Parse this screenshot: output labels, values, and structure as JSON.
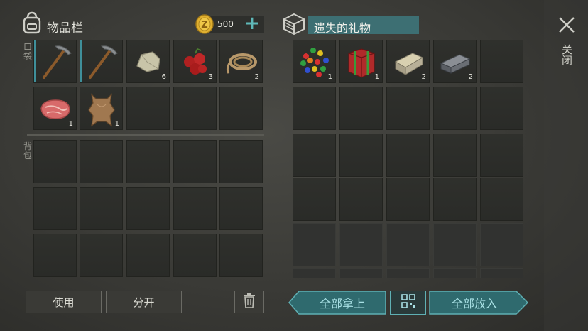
{
  "inventory": {
    "title": "物品栏",
    "pocket_label": "口袋",
    "backpack_label": "背包",
    "coins": "500",
    "add_label": "+",
    "pocket_items": [
      {
        "icon": "pickaxe-icon",
        "count": "",
        "equipped": true
      },
      {
        "icon": "pickaxe-icon",
        "count": "",
        "equipped": true
      },
      {
        "icon": "stone-icon",
        "count": "6"
      },
      {
        "icon": "berries-icon",
        "count": "3"
      },
      {
        "icon": "rope-icon",
        "count": "2"
      },
      {
        "icon": "raw-meat-icon",
        "count": "1"
      },
      {
        "icon": "leather-hide-icon",
        "count": "1"
      }
    ],
    "use_label": "使用",
    "split_label": "分开"
  },
  "gift": {
    "title": "遗失的礼物",
    "items": [
      {
        "icon": "colored-beads-icon",
        "count": "1"
      },
      {
        "icon": "gift-box-icon",
        "count": "1"
      },
      {
        "icon": "stone-brick-icon",
        "count": "2"
      },
      {
        "icon": "iron-ingot-icon",
        "count": "2"
      }
    ],
    "take_all_label": "全部拿上",
    "put_all_label": "全部放入"
  },
  "close_label": "关闭",
  "colors": {
    "accent": "#3f8f9a",
    "coin": "#e0b030",
    "title_bar": "#3d6f73"
  }
}
